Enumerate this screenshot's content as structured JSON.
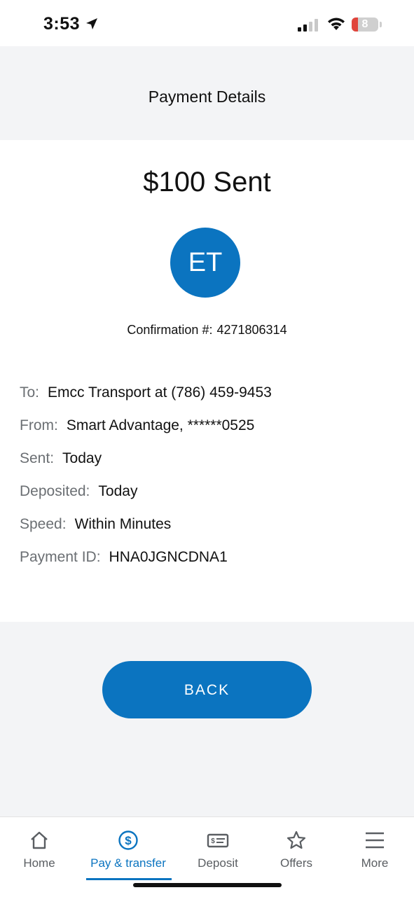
{
  "status_bar": {
    "time": "3:53",
    "battery": "8"
  },
  "header": {
    "title": "Payment Details"
  },
  "payment": {
    "amount_text": "$100 Sent",
    "avatar_initials": "ET",
    "confirmation_label": "Confirmation #:",
    "confirmation_number": "4271806314"
  },
  "details": [
    {
      "label": "To:",
      "value": "Emcc Transport at (786) 459-9453"
    },
    {
      "label": "From:",
      "value": "Smart Advantage, ******0525"
    },
    {
      "label": "Sent:",
      "value": "Today"
    },
    {
      "label": "Deposited:",
      "value": "Today"
    },
    {
      "label": "Speed:",
      "value": "Within Minutes"
    },
    {
      "label": "Payment ID:",
      "value": "HNA0JGNCDNA1"
    }
  ],
  "actions": {
    "back_label": "BACK"
  },
  "bottom_nav": {
    "items": [
      {
        "label": "Home",
        "icon": "home-icon"
      },
      {
        "label": "Pay & transfer",
        "icon": "dollar-circle-icon"
      },
      {
        "label": "Deposit",
        "icon": "check-deposit-icon"
      },
      {
        "label": "Offers",
        "icon": "star-icon"
      },
      {
        "label": "More",
        "icon": "menu-icon"
      }
    ],
    "active": "Pay & transfer"
  },
  "colors": {
    "accent": "#0b74c0",
    "header_bg": "#f3f4f6",
    "label_gray": "#6b6f73"
  }
}
